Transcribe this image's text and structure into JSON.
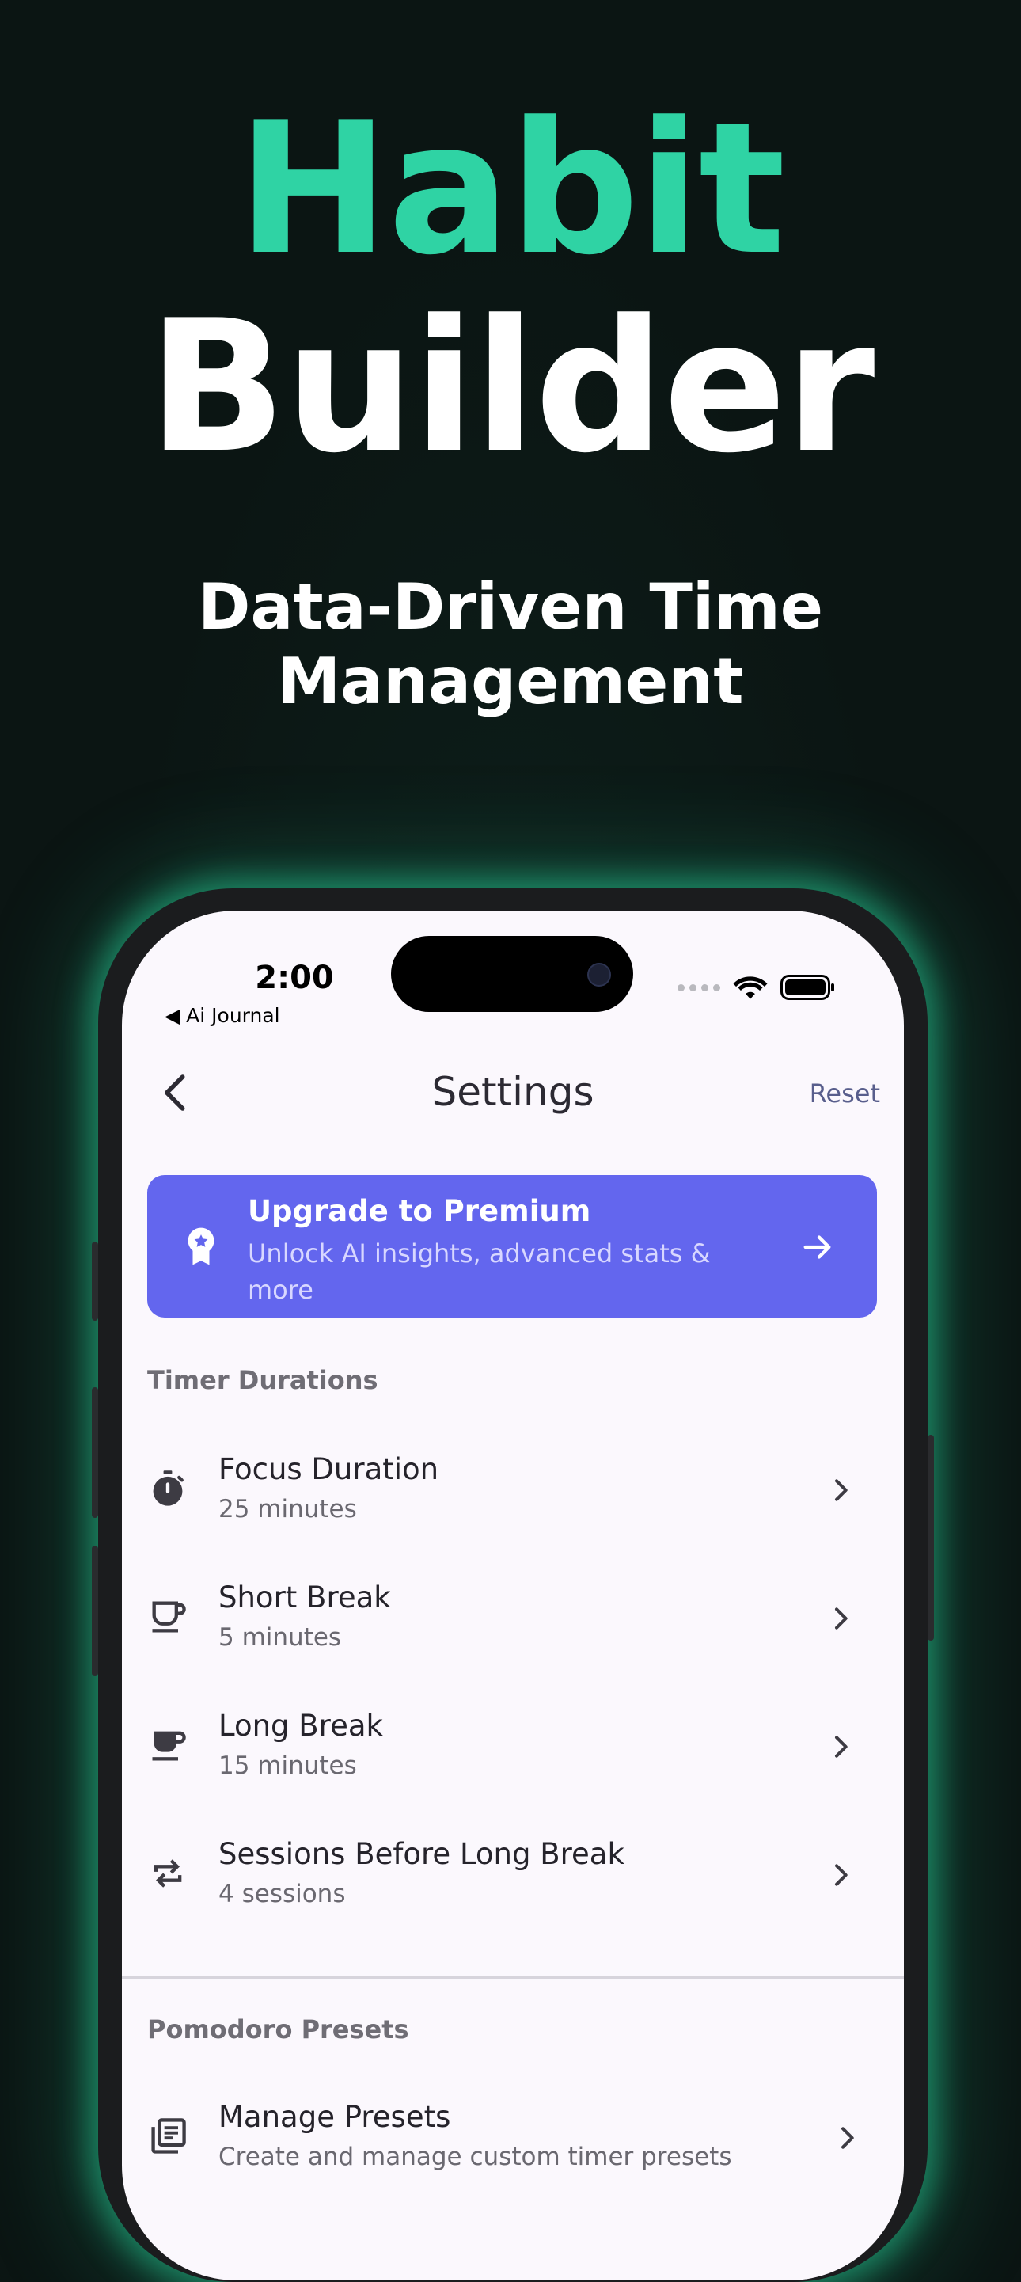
{
  "hero": {
    "title_line1": "Habit",
    "title_line2": "Builder",
    "subtitle_line1": "Data-Driven Time",
    "subtitle_line2": "Management"
  },
  "status_bar": {
    "time": "2:00",
    "back_app": "◀ Ai Journal"
  },
  "nav": {
    "title": "Settings",
    "reset": "Reset"
  },
  "premium": {
    "title": "Upgrade to Premium",
    "subtitle": "Unlock AI insights, advanced stats & more",
    "color": "#6366ee"
  },
  "sections": {
    "timer": "Timer Durations",
    "presets": "Pomodoro Presets"
  },
  "timer_rows": [
    {
      "title": "Focus Duration",
      "subtitle": "25 minutes",
      "icon": "stopwatch-icon"
    },
    {
      "title": "Short Break",
      "subtitle": "5 minutes",
      "icon": "cup-icon"
    },
    {
      "title": "Long Break",
      "subtitle": "15 minutes",
      "icon": "mug-icon"
    },
    {
      "title": "Sessions Before Long Break",
      "subtitle": "4 sessions",
      "icon": "repeat-icon"
    }
  ],
  "preset_rows": [
    {
      "title": "Manage Presets",
      "subtitle": "Create and manage custom timer presets",
      "icon": "library-icon"
    }
  ],
  "colors": {
    "accent": "#2fd3a4",
    "background": "#0b1513",
    "screen": "#fbf8fd"
  }
}
